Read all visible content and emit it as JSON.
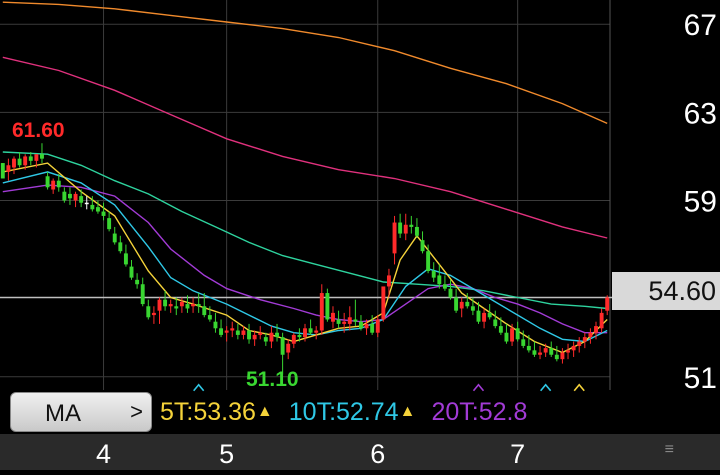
{
  "chart_data": {
    "type": "candlestick",
    "y_ticks": [
      "67",
      "63",
      "59",
      "51"
    ],
    "ylim": [
      50.4,
      68.1
    ],
    "x_ticks": [
      {
        "label": "4",
        "index": 18
      },
      {
        "label": "5",
        "index": 40
      },
      {
        "label": "6",
        "index": 67
      },
      {
        "label": "7",
        "index": 92
      }
    ],
    "n_slots": 109,
    "current_price": "54.60",
    "current_price_value": 54.6,
    "annotations": {
      "high": {
        "label": "61.60",
        "value": 61.6,
        "index": 7
      },
      "low": {
        "label": "51.10",
        "value": 51.1,
        "index": 50
      }
    },
    "colors": {
      "up": "#ff2a2a",
      "down": "#39d631",
      "neutral": "#ffffff"
    },
    "candles": [
      [
        60.7,
        60.7,
        60.0,
        60.0
      ],
      [
        60.3,
        60.9,
        59.9,
        60.6
      ],
      [
        60.5,
        61.0,
        60.2,
        60.9
      ],
      [
        60.9,
        61.2,
        60.5,
        60.6
      ],
      [
        60.6,
        61.1,
        60.4,
        61.0
      ],
      [
        61.0,
        61.2,
        60.6,
        60.8
      ],
      [
        60.8,
        61.1,
        60.5,
        61.1
      ],
      [
        61.1,
        61.6,
        60.7,
        60.9
      ],
      [
        60.1,
        60.3,
        59.5,
        59.6
      ],
      [
        59.5,
        60.0,
        59.3,
        59.9
      ],
      [
        59.9,
        60.2,
        59.4,
        59.6
      ],
      [
        59.4,
        59.6,
        58.9,
        59.0
      ],
      [
        59.3,
        59.6,
        58.8,
        59.1
      ],
      [
        59.0,
        59.4,
        58.7,
        59.3
      ],
      [
        59.2,
        59.5,
        58.7,
        58.9
      ],
      [
        58.9,
        59.2,
        58.6,
        58.9
      ],
      [
        58.8,
        59.2,
        58.5,
        58.6
      ],
      [
        58.7,
        59.0,
        58.4,
        58.5
      ],
      [
        58.5,
        58.9,
        58.1,
        58.3
      ],
      [
        58.2,
        58.5,
        57.6,
        57.7
      ],
      [
        57.5,
        57.8,
        57.0,
        57.1
      ],
      [
        57.1,
        57.4,
        56.6,
        56.7
      ],
      [
        56.6,
        57.0,
        56.0,
        56.1
      ],
      [
        56.0,
        56.3,
        55.4,
        55.5
      ],
      [
        55.4,
        55.7,
        55.0,
        55.2
      ],
      [
        55.2,
        55.5,
        54.2,
        54.3
      ],
      [
        54.2,
        54.5,
        53.6,
        53.7
      ],
      [
        53.8,
        54.2,
        53.4,
        53.9
      ],
      [
        54.0,
        54.6,
        53.4,
        54.5
      ],
      [
        54.5,
        54.9,
        54.0,
        54.2
      ],
      [
        54.2,
        54.5,
        53.9,
        54.3
      ],
      [
        54.2,
        54.6,
        53.8,
        54.1
      ],
      [
        54.2,
        54.6,
        53.9,
        54.4
      ],
      [
        54.3,
        54.7,
        53.9,
        54.1
      ],
      [
        54.2,
        54.6,
        53.9,
        54.3
      ],
      [
        54.3,
        54.8,
        53.9,
        54.2
      ],
      [
        54.2,
        54.8,
        53.7,
        53.8
      ],
      [
        53.8,
        54.2,
        53.5,
        53.6
      ],
      [
        53.5,
        53.9,
        53.0,
        53.2
      ],
      [
        53.2,
        53.6,
        52.8,
        52.9
      ],
      [
        53.0,
        53.3,
        52.6,
        53.1
      ],
      [
        53.1,
        53.5,
        52.8,
        53.2
      ],
      [
        53.1,
        53.4,
        52.7,
        52.9
      ],
      [
        52.9,
        53.3,
        52.7,
        53.1
      ],
      [
        53.1,
        53.4,
        52.5,
        52.7
      ],
      [
        52.7,
        53.1,
        52.4,
        52.9
      ],
      [
        52.9,
        53.3,
        52.7,
        53.0
      ],
      [
        52.8,
        53.0,
        52.4,
        52.6
      ],
      [
        52.6,
        53.3,
        52.3,
        53.0
      ],
      [
        53.0,
        53.4,
        52.6,
        52.8
      ],
      [
        52.8,
        53.0,
        51.1,
        52.0
      ],
      [
        52.1,
        52.7,
        51.8,
        52.5
      ],
      [
        52.5,
        53.0,
        52.3,
        52.9
      ],
      [
        52.9,
        53.2,
        52.6,
        52.8
      ],
      [
        52.8,
        53.4,
        52.6,
        53.2
      ],
      [
        53.2,
        53.6,
        52.9,
        53.0
      ],
      [
        53.0,
        53.3,
        52.7,
        53.1
      ],
      [
        53.1,
        55.2,
        52.9,
        54.8
      ],
      [
        54.8,
        55.0,
        53.5,
        53.6
      ],
      [
        53.5,
        54.2,
        53.2,
        53.9
      ],
      [
        53.6,
        54.0,
        53.2,
        53.4
      ],
      [
        53.4,
        53.9,
        53.0,
        53.5
      ],
      [
        53.4,
        54.2,
        53.1,
        53.7
      ],
      [
        53.6,
        54.5,
        53.3,
        53.5
      ],
      [
        53.5,
        53.8,
        53.1,
        53.2
      ],
      [
        53.2,
        53.6,
        52.9,
        53.4
      ],
      [
        53.4,
        53.8,
        52.9,
        53.0
      ],
      [
        53.0,
        53.8,
        52.8,
        53.6
      ],
      [
        53.6,
        54.2,
        53.5,
        55.1
      ],
      [
        55.1,
        55.9,
        54.6,
        55.6
      ],
      [
        56.6,
        58.3,
        56.1,
        58.0
      ],
      [
        58.0,
        58.4,
        57.3,
        57.5
      ],
      [
        57.5,
        58.4,
        57.2,
        57.9
      ],
      [
        57.9,
        58.3,
        57.5,
        57.8
      ],
      [
        57.8,
        58.2,
        57.3,
        57.4
      ],
      [
        57.2,
        57.6,
        56.6,
        56.7
      ],
      [
        56.7,
        57.0,
        55.7,
        55.8
      ],
      [
        55.8,
        56.2,
        55.3,
        55.5
      ],
      [
        55.6,
        56.1,
        55.0,
        55.2
      ],
      [
        55.2,
        55.6,
        54.9,
        55.0
      ],
      [
        55.0,
        55.4,
        54.5,
        54.6
      ],
      [
        54.6,
        55.0,
        53.9,
        54.0
      ],
      [
        54.1,
        54.6,
        53.7,
        54.4
      ],
      [
        54.4,
        54.8,
        54.1,
        54.2
      ],
      [
        54.2,
        54.6,
        53.8,
        54.0
      ],
      [
        54.0,
        54.4,
        53.4,
        53.5
      ],
      [
        53.5,
        54.1,
        53.2,
        53.9
      ],
      [
        53.9,
        54.3,
        53.6,
        53.7
      ],
      [
        53.6,
        54.0,
        53.2,
        53.3
      ],
      [
        53.3,
        53.7,
        52.9,
        53.0
      ],
      [
        53.0,
        53.4,
        52.5,
        52.6
      ],
      [
        52.6,
        53.4,
        52.4,
        53.2
      ],
      [
        53.2,
        53.5,
        52.6,
        52.7
      ],
      [
        52.7,
        53.1,
        52.3,
        52.4
      ],
      [
        52.4,
        52.9,
        52.1,
        52.2
      ],
      [
        52.2,
        52.6,
        51.9,
        52.0
      ],
      [
        52.0,
        52.4,
        51.8,
        52.1
      ],
      [
        52.1,
        52.5,
        51.9,
        52.3
      ],
      [
        52.3,
        52.6,
        51.9,
        52.0
      ],
      [
        52.0,
        52.4,
        51.7,
        51.8
      ],
      [
        51.8,
        52.3,
        51.6,
        52.1
      ],
      [
        52.1,
        52.5,
        51.8,
        52.2
      ],
      [
        52.2,
        52.6,
        51.9,
        52.4
      ],
      [
        52.4,
        52.8,
        52.1,
        52.6
      ],
      [
        52.6,
        53.0,
        52.3,
        52.8
      ],
      [
        52.8,
        53.2,
        52.5,
        53.0
      ],
      [
        53.0,
        53.5,
        52.7,
        53.3
      ],
      [
        53.2,
        54.1,
        53.0,
        53.9
      ],
      [
        54.0,
        54.7,
        53.8,
        54.6
      ]
    ],
    "series": [
      {
        "name": "5T",
        "color": "#f5d33a",
        "points": [
          [
            0,
            60.3
          ],
          [
            8,
            60.7
          ],
          [
            14,
            59.4
          ],
          [
            20,
            58.3
          ],
          [
            26,
            55.8
          ],
          [
            30,
            54.6
          ],
          [
            34,
            54.3
          ],
          [
            40,
            53.8
          ],
          [
            44,
            53.1
          ],
          [
            48,
            52.9
          ],
          [
            52,
            52.6
          ],
          [
            56,
            52.9
          ],
          [
            60,
            53.2
          ],
          [
            64,
            53.3
          ],
          [
            68,
            53.9
          ],
          [
            71,
            56.3
          ],
          [
            74,
            57.4
          ],
          [
            78,
            56.1
          ],
          [
            82,
            54.8
          ],
          [
            86,
            54.1
          ],
          [
            90,
            53.4
          ],
          [
            95,
            52.6
          ],
          [
            100,
            52.1
          ],
          [
            104,
            52.6
          ],
          [
            108,
            53.6
          ]
        ]
      },
      {
        "name": "10T",
        "color": "#2fc8e6",
        "points": [
          [
            0,
            59.8
          ],
          [
            8,
            60.3
          ],
          [
            14,
            59.8
          ],
          [
            20,
            58.8
          ],
          [
            26,
            56.9
          ],
          [
            30,
            55.5
          ],
          [
            34,
            54.9
          ],
          [
            40,
            54.3
          ],
          [
            44,
            53.8
          ],
          [
            48,
            53.3
          ],
          [
            52,
            53.0
          ],
          [
            56,
            52.9
          ],
          [
            60,
            53.1
          ],
          [
            64,
            53.2
          ],
          [
            68,
            53.6
          ],
          [
            72,
            55.1
          ],
          [
            76,
            55.9
          ],
          [
            80,
            55.6
          ],
          [
            84,
            55.0
          ],
          [
            88,
            54.4
          ],
          [
            92,
            53.8
          ],
          [
            96,
            53.2
          ],
          [
            100,
            52.7
          ],
          [
            104,
            52.6
          ],
          [
            108,
            53.1
          ]
        ]
      },
      {
        "name": "20T",
        "color": "#a23bd6",
        "points": [
          [
            0,
            59.4
          ],
          [
            8,
            59.7
          ],
          [
            14,
            59.6
          ],
          [
            20,
            59.2
          ],
          [
            26,
            58.0
          ],
          [
            30,
            56.8
          ],
          [
            36,
            55.6
          ],
          [
            40,
            55.0
          ],
          [
            46,
            54.5
          ],
          [
            52,
            54.1
          ],
          [
            56,
            53.8
          ],
          [
            60,
            53.6
          ],
          [
            64,
            53.5
          ],
          [
            68,
            53.6
          ],
          [
            72,
            54.3
          ],
          [
            76,
            55.0
          ],
          [
            80,
            55.2
          ],
          [
            84,
            55.0
          ],
          [
            88,
            54.6
          ],
          [
            92,
            54.3
          ],
          [
            96,
            53.9
          ],
          [
            100,
            53.4
          ],
          [
            104,
            53.0
          ],
          [
            108,
            53.0
          ]
        ]
      },
      {
        "name": "",
        "color": "#2ed39e",
        "points": [
          [
            0,
            61.2
          ],
          [
            8,
            61.1
          ],
          [
            14,
            60.6
          ],
          [
            20,
            59.9
          ],
          [
            26,
            59.3
          ],
          [
            32,
            58.5
          ],
          [
            38,
            57.8
          ],
          [
            44,
            57.1
          ],
          [
            50,
            56.5
          ],
          [
            56,
            56.1
          ],
          [
            62,
            55.7
          ],
          [
            68,
            55.3
          ],
          [
            74,
            55.2
          ],
          [
            80,
            55.1
          ],
          [
            86,
            54.9
          ],
          [
            92,
            54.6
          ],
          [
            98,
            54.3
          ],
          [
            104,
            54.2
          ],
          [
            108,
            54.1
          ]
        ]
      },
      {
        "name": "",
        "color": "#e0317d",
        "points": [
          [
            0,
            65.5
          ],
          [
            10,
            64.9
          ],
          [
            20,
            64.0
          ],
          [
            30,
            62.9
          ],
          [
            40,
            61.8
          ],
          [
            50,
            61.0
          ],
          [
            60,
            60.4
          ],
          [
            70,
            60.0
          ],
          [
            80,
            59.4
          ],
          [
            90,
            58.6
          ],
          [
            100,
            57.8
          ],
          [
            108,
            57.3
          ]
        ]
      },
      {
        "name": "",
        "color": "#f08a2c",
        "points": [
          [
            0,
            68.0
          ],
          [
            10,
            67.9
          ],
          [
            20,
            67.7
          ],
          [
            30,
            67.4
          ],
          [
            40,
            67.1
          ],
          [
            50,
            66.8
          ],
          [
            60,
            66.4
          ],
          [
            70,
            65.8
          ],
          [
            80,
            65.0
          ],
          [
            90,
            64.3
          ],
          [
            100,
            63.4
          ],
          [
            108,
            62.5
          ]
        ]
      }
    ],
    "markers": [
      {
        "index": 35,
        "value": 50.5,
        "color": "#2fc8e6"
      },
      {
        "index": 85,
        "value": 50.5,
        "color": "#a23bd6"
      },
      {
        "index": 97,
        "value": 50.5,
        "color": "#2fc8e6"
      },
      {
        "index": 103,
        "value": 50.5,
        "color": "#f5d33a"
      }
    ],
    "grid": true
  },
  "ma_button": {
    "label": "MA",
    "chevron": ">"
  },
  "legend": [
    {
      "text": "5T:53.36",
      "color": "#f5d33a",
      "arrow": "▲"
    },
    {
      "text": "10T:52.74",
      "color": "#2fc8e6",
      "arrow": "▲"
    },
    {
      "text": "20T:52.8",
      "color": "#a23bd6",
      "arrow": ""
    }
  ],
  "scroll_icon": "scroll-handle-icon"
}
